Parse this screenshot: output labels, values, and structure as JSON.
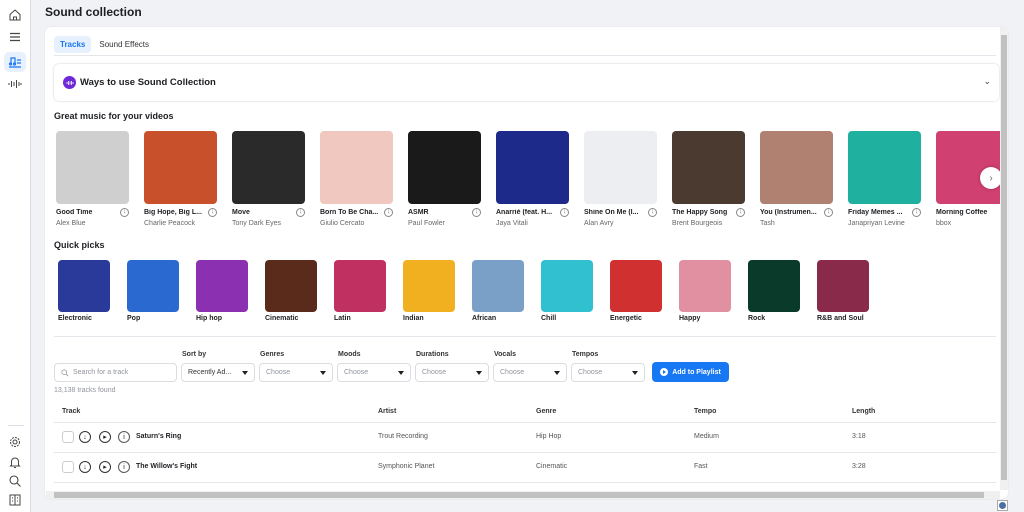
{
  "page_title": "Sound collection",
  "tabs": [
    {
      "label": "Tracks",
      "active": true
    },
    {
      "label": "Sound Effects",
      "active": false
    }
  ],
  "ways_banner": {
    "title": "Ways to use Sound Collection"
  },
  "featured": {
    "title": "Great music for your videos",
    "cards": [
      {
        "title": "Good Time",
        "artist": "Alex Blue",
        "color": "#cfcfcf"
      },
      {
        "title": "Big Hope, Big L...",
        "artist": "Charlie Peacock",
        "color": "#c8502a"
      },
      {
        "title": "Move",
        "artist": "Tony Dark Eyes",
        "color": "#2a2a2a"
      },
      {
        "title": "Born To Be Cha...",
        "artist": "Giulio Cercato",
        "color": "#f0c8c0"
      },
      {
        "title": "ASMR",
        "artist": "Paul Fowler",
        "color": "#1a1a1a"
      },
      {
        "title": "Anarriè (feat. H...",
        "artist": "Jaya Vitali",
        "color": "#1d2a8a"
      },
      {
        "title": "Shine On Me (I...",
        "artist": "Alan Avry",
        "color": "#eceef2"
      },
      {
        "title": "The Happy Song",
        "artist": "Brent Bourgeois",
        "color": "#4a3a30"
      },
      {
        "title": "You (Instrumen...",
        "artist": "Tash",
        "color": "#b08070"
      },
      {
        "title": "Friday Memes ...",
        "artist": "Janapriyan Levine",
        "color": "#20b0a0"
      },
      {
        "title": "Morning Coffee",
        "artist": "bbox",
        "color": "#d04070"
      }
    ]
  },
  "quick_picks": {
    "title": "Quick picks",
    "items": [
      {
        "label": "Electronic",
        "color": "#2a3a9a"
      },
      {
        "label": "Pop",
        "color": "#2a6ad0"
      },
      {
        "label": "Hip hop",
        "color": "#8a30b0"
      },
      {
        "label": "Cinematic",
        "color": "#5a2a1a"
      },
      {
        "label": "Latin",
        "color": "#c03060"
      },
      {
        "label": "Indian",
        "color": "#f0b020"
      },
      {
        "label": "African",
        "color": "#7aa0c8"
      },
      {
        "label": "Chill",
        "color": "#30c0d0"
      },
      {
        "label": "Energetic",
        "color": "#d03030"
      },
      {
        "label": "Happy",
        "color": "#e090a0"
      },
      {
        "label": "Rock",
        "color": "#0a3a2a"
      },
      {
        "label": "R&B and Soul",
        "color": "#8a2a4a"
      }
    ]
  },
  "filters": {
    "search_placeholder": "Search for a track",
    "sort_label": "Sort by",
    "sort_value": "Recently Ad...",
    "genres_label": "Genres",
    "moods_label": "Moods",
    "durations_label": "Durations",
    "vocals_label": "Vocals",
    "tempos_label": "Tempos",
    "choose": "Choose",
    "add_playlist": "Add to Playlist",
    "found": "13,138 tracks found"
  },
  "table": {
    "headers": {
      "track": "Track",
      "artist": "Artist",
      "genre": "Genre",
      "tempo": "Tempo",
      "length": "Length"
    },
    "rows": [
      {
        "track": "Saturn's Ring",
        "artist": "Trout Recording",
        "genre": "Hip Hop",
        "tempo": "Medium",
        "length": "3:18"
      },
      {
        "track": "The Willow's Fight",
        "artist": "Symphonic Planet",
        "genre": "Cinematic",
        "tempo": "Fast",
        "length": "3:28"
      }
    ]
  },
  "colors": {
    "accent": "#1877f2",
    "ways_icon": "#6c28d9"
  }
}
